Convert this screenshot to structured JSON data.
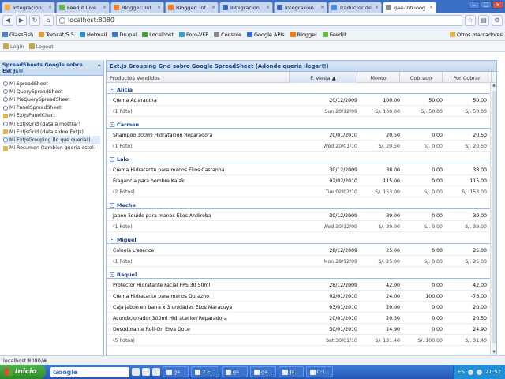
{
  "browser": {
    "tabs": [
      {
        "label": "Integracion",
        "color": "#f0a830"
      },
      {
        "label": "Feedjit Live",
        "color": "#66b845"
      },
      {
        "label": "Blogger: Inf",
        "color": "#f07d1a"
      },
      {
        "label": "Blogger: Inf",
        "color": "#f07d1a"
      },
      {
        "label": "Integracion",
        "color": "#3e66b9"
      },
      {
        "label": "Integracion",
        "color": "#3e66b9"
      },
      {
        "label": "Traductor de",
        "color": "#4a8ae0"
      },
      {
        "label": "gae-intGoog",
        "color": "#888888",
        "active": true
      }
    ],
    "address": "localhost:8080",
    "bookmarks": [
      "GlassFish",
      "Tomcat/5.5",
      "Hotmail",
      "Drupal",
      "Localhost",
      "Foro-VFP",
      "Console",
      "Google APIs",
      "Blogger",
      "Feedjit"
    ],
    "other_bookmarks": "Otros marcadores"
  },
  "loginbar": {
    "login": "Login",
    "logout": "Logout"
  },
  "left_panel": {
    "title_line1": "SpreadSheets Google sobre",
    "title_line2": "Ext Js®",
    "items": [
      "Mi SpreadSheet",
      "Mi QuerySpreadSheet",
      "Mi PieQuerySpreadSheet",
      "Mi PanelSpreadSheet",
      "Mi ExtJsPanelChart",
      "Mi ExtJsGrid (data a mostrar)",
      "Mi ExtJsGrid (data sobre ExtJs)",
      "Mi ExtJsGrouping (lo que queria!)",
      "Mi Resumen (tambien queria esto!)"
    ]
  },
  "grid": {
    "title": "Ext.Js Grouping Grid sobre Google SpreadSheet (Adonde queria llegar!!)",
    "columns": [
      "Productos Vendidos",
      "F. Venta",
      "Monto",
      "Cobrado",
      "Por Cobrar"
    ],
    "sorted_column": "F. Venta",
    "groups": [
      {
        "name": "Alicia",
        "rows": [
          [
            "Crema Aclaradora",
            "20/12/2009",
            "100.00",
            "50.00",
            "50.00"
          ]
        ],
        "summary": [
          "(1 Pdto)",
          "Sun 20/12/09",
          "S/. 100.00",
          "S/. 50.00",
          "S/. 50.00"
        ]
      },
      {
        "name": "Carmen",
        "rows": [
          [
            "Shampoo 300ml Hidratacion Reparadora",
            "20/01/2010",
            "20.50",
            "0.00",
            "20.50"
          ]
        ],
        "summary": [
          "(1 Pdto)",
          "Wed 20/01/10",
          "S/. 20.50",
          "S/. 0.00",
          "S/. 20.50"
        ]
      },
      {
        "name": "Lalo",
        "rows": [
          [
            "Crema Hidratante para manos Ekos Castanha",
            "30/12/2009",
            "38.00",
            "0.00",
            "38.00"
          ],
          [
            "Fragancia para hombre Kaiak",
            "02/02/2010",
            "115.00",
            "0.00",
            "115.00"
          ]
        ],
        "summary": [
          "(2 Pdtos)",
          "Tue 02/02/10",
          "S/. 153.00",
          "S/. 0.00",
          "S/. 153.00"
        ]
      },
      {
        "name": "Meche",
        "rows": [
          [
            "Jabon liquido para manos Ekos Andiroba",
            "30/12/2009",
            "39.00",
            "0.00",
            "39.00"
          ]
        ],
        "summary": [
          "(1 Pdto)",
          "Wed 30/12/09",
          "S/. 39.00",
          "S/. 0.00",
          "S/. 39.00"
        ]
      },
      {
        "name": "Miguel",
        "rows": [
          [
            "Colonia L'esence",
            "28/12/2009",
            "25.00",
            "0.00",
            "25.00"
          ]
        ],
        "summary": [
          "(1 Pdto)",
          "Mon 28/12/09",
          "S/. 25.00",
          "S/. 0.00",
          "S/. 25.00"
        ]
      },
      {
        "name": "Raquel",
        "rows": [
          [
            "Protector Hidratante Facial FPS 30 50ml",
            "28/12/2009",
            "42.00",
            "0.00",
            "42.00"
          ],
          [
            "Crema Hidratante para manos Durazno",
            "02/01/2010",
            "24.00",
            "100.00",
            "-76.00"
          ],
          [
            "Caja jabon en barra x 3 unidades Ekos Maracuya",
            "03/01/2010",
            "20.00",
            "0.00",
            "20.00"
          ],
          [
            "Acondicionador 300ml Hidratacion Reparadora",
            "20/01/2010",
            "20.50",
            "0.00",
            "20.50"
          ],
          [
            "Desodorante Roll-On Erva Doce",
            "30/01/2010",
            "24.90",
            "0.00",
            "24.90"
          ]
        ],
        "summary": [
          "(5 Pdtos)",
          "Sat 30/01/10",
          "S/. 131.40",
          "S/. 100.00",
          "S/. 31.40"
        ]
      }
    ]
  },
  "status": "localhost:8080/#",
  "taskbar": {
    "start": "Inicio",
    "google": "Google",
    "buttons": [
      "gа...",
      "2 E...",
      "ga...",
      "ga...",
      "Ja...",
      "D:\\..."
    ],
    "lang": "ES",
    "time": "21:52"
  }
}
